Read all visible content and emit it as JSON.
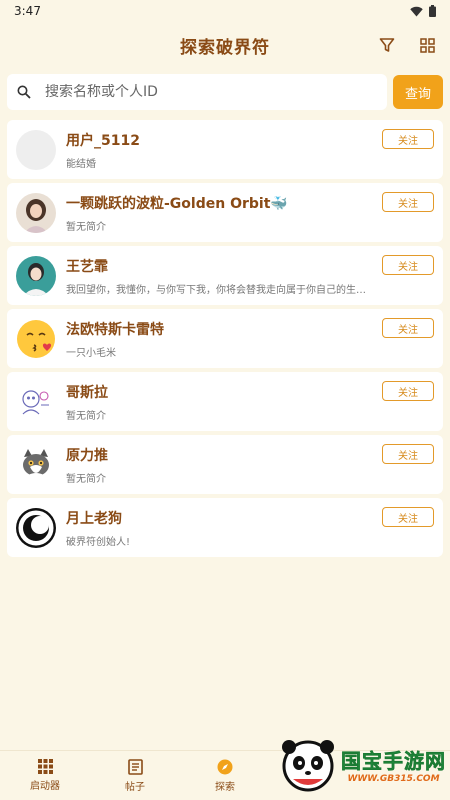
{
  "status": {
    "time": "3:47"
  },
  "header": {
    "title": "探索破界符"
  },
  "search": {
    "placeholder": "搜索名称或个人ID",
    "button_label": "查询"
  },
  "users": [
    {
      "name": "用户_5112",
      "bio": "能结婚",
      "follow_label": "关注",
      "avatar": "blank"
    },
    {
      "name": "一颗跳跃的波粒-Golden Orbit🐳",
      "bio": "暂无简介",
      "follow_label": "关注",
      "avatar": "photo-girl"
    },
    {
      "name": "王艺霏",
      "bio": "我回望你，我懂你，与你写下我，你将会替我走向属于你自己的生活，你与我同在。",
      "follow_label": "关注",
      "avatar": "photo-teal"
    },
    {
      "name": "法欧特斯卡雷特",
      "bio": "一只小毛米",
      "follow_label": "关注",
      "avatar": "emoji-kiss"
    },
    {
      "name": "哥斯拉",
      "bio": "暂无简介",
      "follow_label": "关注",
      "avatar": "sketch"
    },
    {
      "name": "原力推",
      "bio": "暂无简介",
      "follow_label": "关注",
      "avatar": "cat"
    },
    {
      "name": "月上老狗",
      "bio": "破界符创始人!",
      "follow_label": "关注",
      "avatar": "moon-logo"
    }
  ],
  "bottom_nav": [
    {
      "label": "启动器",
      "icon": "grid-icon"
    },
    {
      "label": "帖子",
      "icon": "document-icon"
    },
    {
      "label": "探索",
      "icon": "compass-icon"
    }
  ],
  "watermark": {
    "title": "国宝手游网",
    "url": "WWW.GB315.COM"
  },
  "colors": {
    "accent": "#f1a21a",
    "title": "#8a4b16",
    "background": "#fbf6e6"
  }
}
